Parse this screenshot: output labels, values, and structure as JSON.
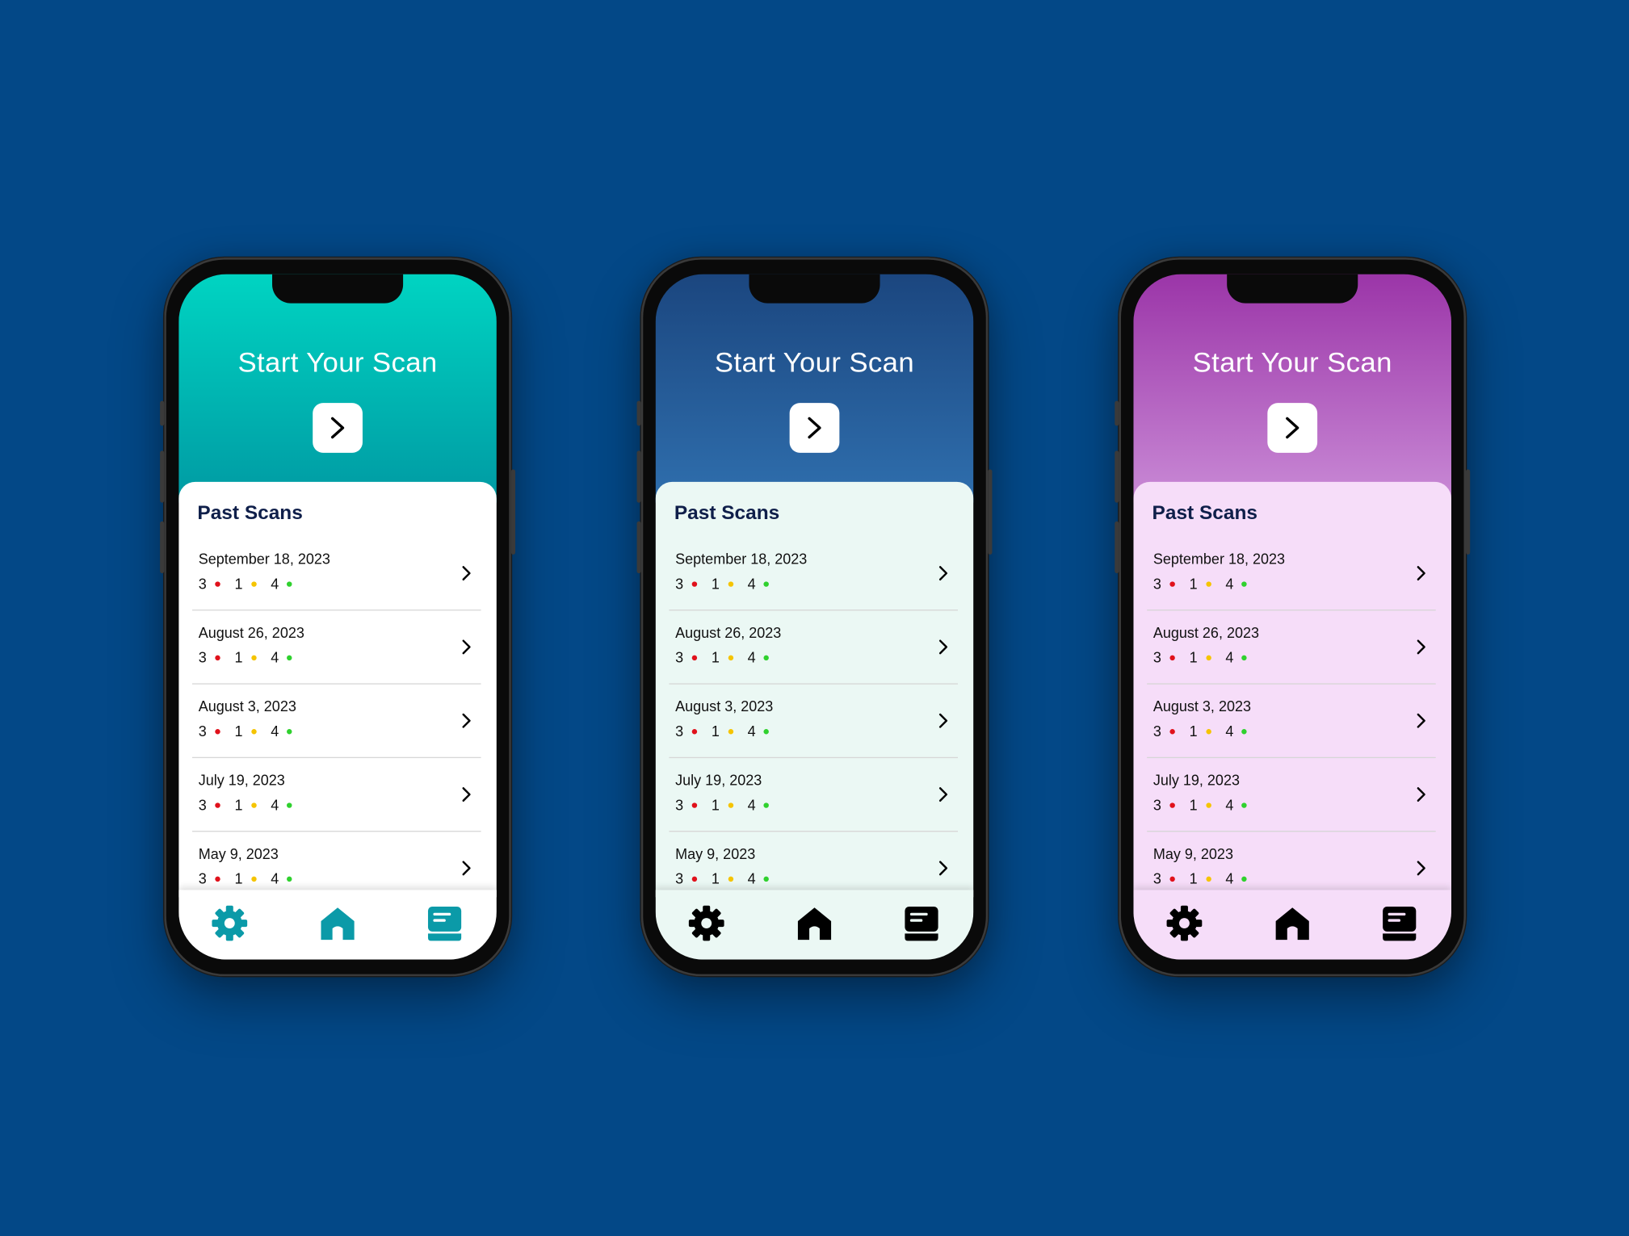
{
  "phones": [
    {
      "theme": "teal",
      "hero_gradient": [
        "#00d4c2",
        "#009aa3"
      ],
      "sheet_bg": "#ffffff",
      "tabbar_bg": "#ffffff",
      "icon_color": "#0b9aa8",
      "hero_title": "Start Your Scan",
      "past_scans_title": "Past Scans"
    },
    {
      "theme": "navy",
      "hero_gradient": [
        "#1b467f",
        "#2f6fae"
      ],
      "sheet_bg": "#ebf8f4",
      "tabbar_bg": "#ebf8f4",
      "icon_color": "#000000",
      "hero_title": "Start Your Scan",
      "past_scans_title": "Past Scans"
    },
    {
      "theme": "purple",
      "hero_gradient": [
        "#9b35a8",
        "#c98ad6"
      ],
      "sheet_bg": "#f6ddf9",
      "tabbar_bg": "#f6ddf9",
      "icon_color": "#000000",
      "hero_title": "Start Your Scan",
      "past_scans_title": "Past Scans"
    }
  ],
  "scans": [
    {
      "date": "September 18, 2023",
      "red": "3",
      "yellow": "1",
      "green": "4"
    },
    {
      "date": "August 26, 2023",
      "red": "3",
      "yellow": "1",
      "green": "4"
    },
    {
      "date": "August 3, 2023",
      "red": "3",
      "yellow": "1",
      "green": "4"
    },
    {
      "date": "July 19, 2023",
      "red": "3",
      "yellow": "1",
      "green": "4"
    },
    {
      "date": "May 9, 2023",
      "red": "3",
      "yellow": "1",
      "green": "4"
    }
  ],
  "status_colors": {
    "red": "#e0111b",
    "yellow": "#f5c400",
    "green": "#2fd12e"
  },
  "tabs": [
    {
      "icon": "gear-icon"
    },
    {
      "icon": "home-icon"
    },
    {
      "icon": "book-icon"
    }
  ]
}
